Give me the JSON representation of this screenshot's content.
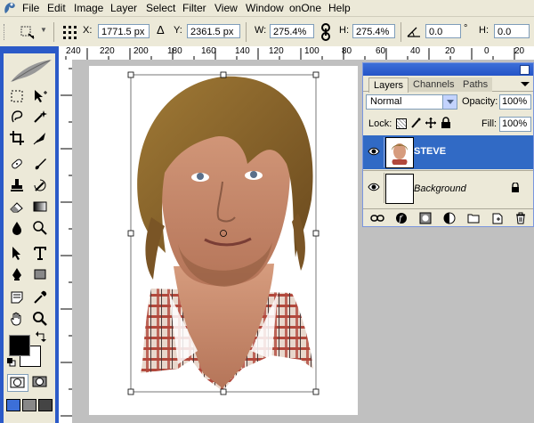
{
  "menubar": {
    "items": [
      "File",
      "Edit",
      "Image",
      "Layer",
      "Select",
      "Filter",
      "View",
      "Window",
      "onOne",
      "Help"
    ]
  },
  "options": {
    "x_label": "X:",
    "x_value": "1771.5 px",
    "y_label": "Y:",
    "y_value": "2361.5 px",
    "w_label": "W:",
    "w_value": "275.4%",
    "h_label": "H:",
    "h_value": "275.4%",
    "rotate_value": "0.0",
    "rotate_unit": "°",
    "hskew_label": "H:",
    "hskew_value": "0.0",
    "hskew_unit": "°",
    "delta_symbol": "Δ"
  },
  "ruler": {
    "top_numbers": [
      "240",
      "220",
      "200",
      "180",
      "160",
      "140",
      "120",
      "100",
      "80",
      "60",
      "40",
      "20",
      "0",
      "20"
    ]
  },
  "layers_panel": {
    "tabs": [
      "Layers",
      "Channels",
      "Paths"
    ],
    "blend_mode": "Normal",
    "opacity_label": "Opacity:",
    "opacity_value": "100%",
    "lock_label": "Lock:",
    "fill_label": "Fill:",
    "fill_value": "100%",
    "layers": [
      {
        "name": "STEVE",
        "selected": true
      },
      {
        "name": "Background",
        "selected": false
      }
    ]
  },
  "colors": {
    "toolbox_blue": "#2b5ac8",
    "panel_bg": "#ece9d8",
    "selected_layer": "#316ac5"
  }
}
